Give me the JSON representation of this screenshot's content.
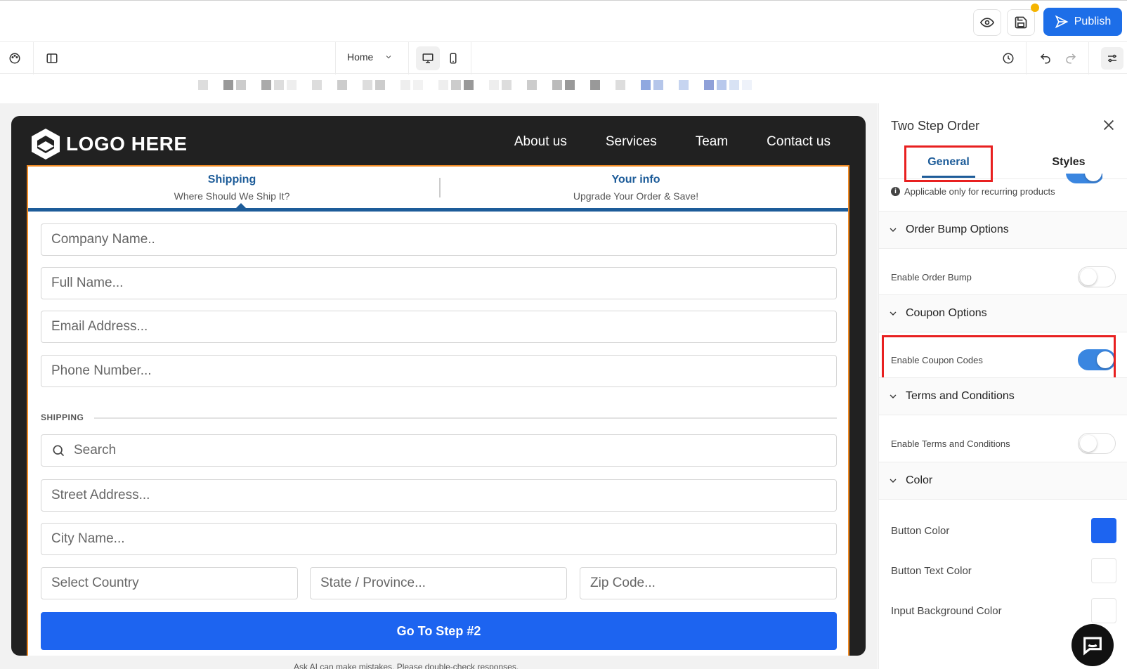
{
  "topbar": {
    "publish_label": "Publish",
    "preview_icon": "eye-icon",
    "save_icon": "save-icon"
  },
  "toolbar": {
    "page_selected": "Home"
  },
  "site": {
    "logo_text": "LOGO HERE",
    "nav": [
      "About us",
      "Services",
      "Team",
      "Contact us"
    ],
    "steps": [
      {
        "title": "Shipping",
        "subtitle": "Where Should We Ship It?"
      },
      {
        "title": "Your info",
        "subtitle": "Upgrade Your Order & Save!"
      }
    ],
    "fields": {
      "company": "Company Name..",
      "full_name": "Full Name...",
      "email": "Email Address...",
      "phone": "Phone Number...",
      "search": "Search",
      "street": "Street Address...",
      "city": "City Name...",
      "country": "Select Country",
      "state": "State / Province...",
      "zip": "Zip Code..."
    },
    "shipping_label": "SHIPPING",
    "go_button": "Go To Step #2",
    "disclaimer": "Ask AI can make mistakes. Please double-check responses."
  },
  "panel": {
    "title": "Two Step Order",
    "tabs": {
      "general": "General",
      "styles": "Styles"
    },
    "info_note": "Applicable only for recurring products",
    "sections": {
      "order_bump": "Order Bump Options",
      "coupon": "Coupon Options",
      "terms": "Terms and Conditions",
      "color": "Color"
    },
    "options": {
      "enable_order_bump": {
        "label": "Enable Order Bump",
        "on": false
      },
      "enable_coupon": {
        "label": "Enable Coupon Codes",
        "on": true
      },
      "enable_terms": {
        "label": "Enable Terms and Conditions",
        "on": false
      }
    },
    "colors": {
      "button_color": {
        "label": "Button Color",
        "value": "#1d64f0"
      },
      "button_text_color": {
        "label": "Button Text Color",
        "value": "#ffffff"
      },
      "input_bg_color": {
        "label": "Input Background Color",
        "value": "#ffffff"
      }
    }
  },
  "theme": {
    "accent": "#1d6ee8",
    "step_color": "#1d5c99",
    "form_border": "#f08a24",
    "highlight": "#e82020"
  }
}
